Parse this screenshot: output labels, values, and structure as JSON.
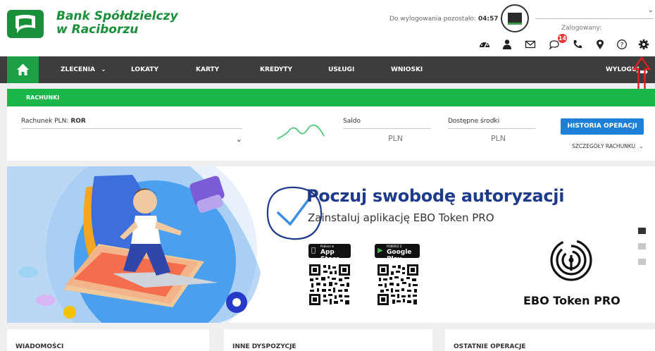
{
  "bank": {
    "name_line1": "Bank Spółdzielczy",
    "name_line2": "w Raciborzu"
  },
  "session": {
    "label": "Do wylogowania pozostało:",
    "time": "04:57"
  },
  "user": {
    "logged_label": "Zalogowany:",
    "logged_name": ""
  },
  "notifications": {
    "count": "14"
  },
  "nav": {
    "items": [
      "ZLECENIA",
      "LOKATY",
      "KARTY",
      "KREDYTY",
      "USŁUGI",
      "WNIOSKI"
    ],
    "logout": "WYLOGUJ"
  },
  "section": {
    "title": "RACHUNKI"
  },
  "account": {
    "label": "Rachunek PLN:",
    "type": "ROR",
    "saldo_label": "Saldo",
    "saldo_currency": "PLN",
    "available_label": "Dostępne środki",
    "available_currency": "PLN",
    "history_button": "HISTORIA OPERACJI",
    "details_link": "SZCZEGÓŁY RACHUNKU"
  },
  "banner": {
    "headline": "Poczuj swobodę autoryzacji",
    "subline": "Zainstaluj aplikację EBO Token PRO",
    "appstore_small": "Pobierz w",
    "appstore_label": "App Store",
    "googleplay_small": "POBIERZ Z",
    "googleplay_label": "Google Play",
    "token_name": "EBO Token PRO"
  },
  "bottom": {
    "col1": "WIADOMOŚCI",
    "col2": "INNE DYSPOZYCJE",
    "col3": "OSTATNIE OPERACJE"
  },
  "colors": {
    "brand_green": "#1a8f3a",
    "bar_green": "#19b64a",
    "nav_dark": "#3d3d3d",
    "button_blue": "#1d7fd6",
    "headline_blue": "#1e3a8c",
    "arrow_red": "#e02020"
  },
  "icons": [
    "speedometer-icon",
    "user-icon",
    "envelope-icon",
    "chat-icon",
    "phone-icon",
    "location-icon",
    "help-icon",
    "gear-icon",
    "home-icon",
    "logout-icon"
  ]
}
